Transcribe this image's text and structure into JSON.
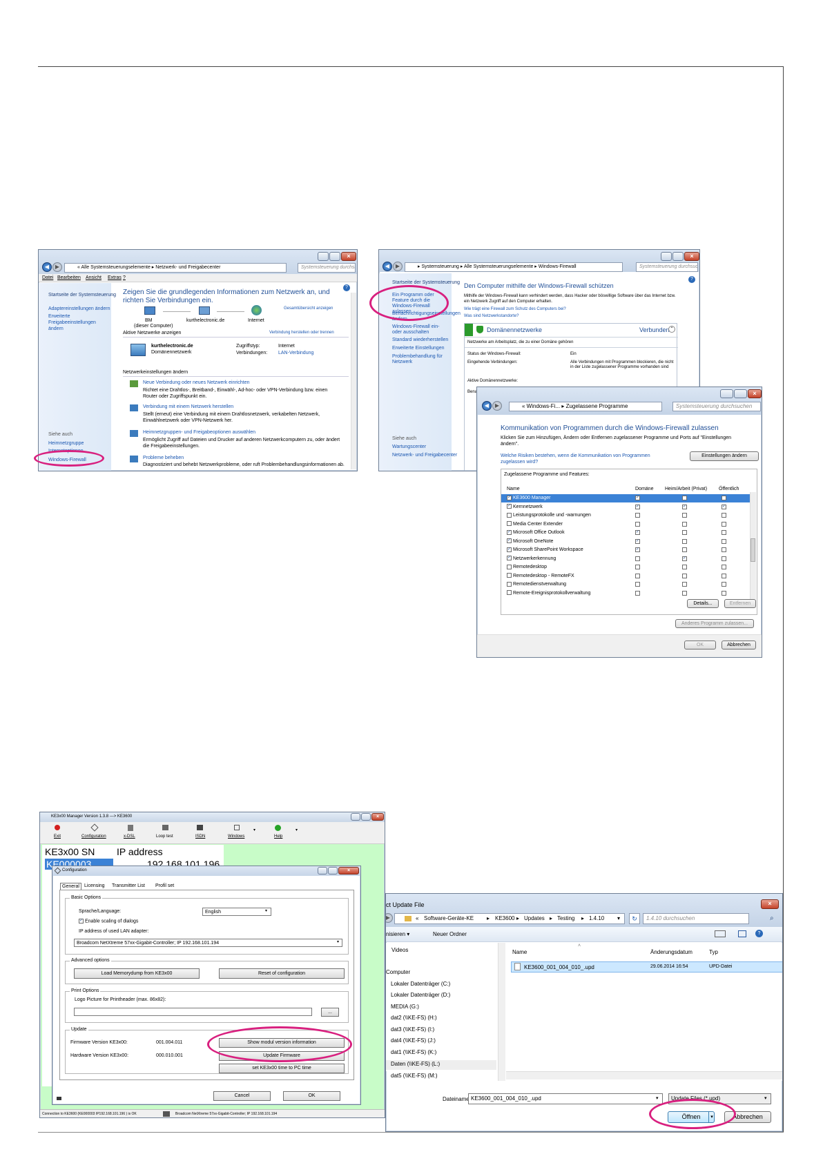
{
  "network_window": {
    "address": "« Alle Systemsteuerungselemente ▸ Netzwerk- und Freigabecenter",
    "search": "Systemsteuerung durchsuchen",
    "menu": [
      "Datei",
      "Bearbeiten",
      "Ansicht",
      "Extras",
      "?"
    ],
    "sidebar": [
      "Startseite der Systemsteuerung",
      "Adaptereinstellungen ändern",
      "Erweiterte Freigabeeinstellungen ändern"
    ],
    "see_also": "Siehe auch",
    "see_also_items": [
      "Heimnetzgruppe",
      "Internetoptionen",
      "Windows-Firewall"
    ],
    "heading": "Zeigen Sie die grundlegenden Informationen zum Netzwerk an, und richten Sie Verbindungen ein.",
    "full_map": "Gesamtübersicht anzeigen",
    "nodes": [
      "BM",
      "(dieser Computer)",
      "kurthelectronic.de",
      "Internet"
    ],
    "active_label": "Aktive Netzwerke anzeigen",
    "connect_link": "Verbindung herstellen oder trennen",
    "network_name": "kurthelectronic.de",
    "network_type": "Domänennetzwerk",
    "access_type_label": "Zugriffstyp:",
    "access_type": "Internet",
    "connections_label": "Verbindungen:",
    "connections": "LAN-Verbindung",
    "change_label": "Netzwerkeinstellungen ändern",
    "tasks": [
      {
        "title": "Neue Verbindung oder neues Netzwerk einrichten",
        "desc": "Richtet eine Drahtlos-, Breitband-, Einwähl-, Ad-hoc- oder VPN-Verbindung bzw. einen Router oder Zugriffspunkt ein."
      },
      {
        "title": "Verbindung mit einem Netzwerk herstellen",
        "desc": "Stellt (erneut) eine Verbindung mit einem Drahtlosnetzwerk, verkabelten Netzwerk, Einwählnetzwerk oder VPN-Netzwerk her."
      },
      {
        "title": "Heimnetzgruppen- und Freigabeoptionen auswählen",
        "desc": "Ermöglicht Zugriff auf Dateien und Drucker auf anderen Netzwerkcomputern zu, oder ändert die Freigabeeinstellungen."
      },
      {
        "title": "Probleme beheben",
        "desc": "Diagnostiziert und behebt Netzwerkprobleme, oder ruft Problembehandlungsinformationen ab."
      }
    ]
  },
  "firewall_window": {
    "address": "▸ Systemsteuerung ▸ Alle Systemsteuerungselemente ▸ Windows-Firewall",
    "search": "Systemsteuerung durchsuchen",
    "sidebar": [
      "Startseite der Systemsteuerung",
      "Ein Programm oder Feature durch die Windows-Firewall zulassen",
      "Benachrichtigungseinstellungen ändern",
      "Windows-Firewall ein- oder ausschalten",
      "Standard wiederherstellen",
      "Erweiterte Einstellungen",
      "Problembehandlung für Netzwerk"
    ],
    "see_also": "Siehe auch",
    "see_also_items": [
      "Wartungscenter",
      "Netzwerk- und Freigabecenter"
    ],
    "heading": "Den Computer mithilfe der Windows-Firewall schützen",
    "intro": "Mithilfe der Windows-Firewall kann verhindert werden, dass Hacker oder böswillige Software über das Internet bzw. ein Netzwerk Zugriff auf den Computer erhalten.",
    "link1": "Wie trägt eine Firewall zum Schutz des Computers bei?",
    "link2": "Was sind Netzwerkstandorte?",
    "domain_net": "Domänennetzwerke",
    "connected": "Verbunden",
    "domain_desc": "Netzwerke am Arbeitsplatz, die zu einer Domäne gehören",
    "status_label": "Status der Windows-Firewall:",
    "status": "Ein",
    "incoming_label": "Eingehende Verbindungen:",
    "incoming": "Alle Verbindungen mit Programmen blockieren, die nicht in der Liste zugelassener Programme vorhanden sind",
    "active_domain": "Aktive Domänennetzwerke:",
    "notify_partial": "Benachrichtigungsstatus:"
  },
  "allowed_window": {
    "address": "« Windows-Fi... ▸ Zugelassene Programme",
    "search": "Systemsteuerung durchsuchen",
    "heading": "Kommunikation von Programmen durch die Windows-Firewall zulassen",
    "intro": "Klicken Sie zum Hinzufügen, Ändern oder Entfernen zugelassener Programme und Ports auf \"Einstellungen ändern\".",
    "risk_link": "Welche Risiken bestehen, wenn die Kommunikation von Programmen zugelassen wird?",
    "change_btn": "Einstellungen ändern",
    "list_label": "Zugelassene Programme und Features:",
    "columns": [
      "Name",
      "Domäne",
      "Heim/Arbeit (Privat)",
      "Öffentlich"
    ],
    "rows": [
      {
        "name": "KE3600 Manager",
        "c": [
          true,
          false,
          false
        ],
        "on": true
      },
      {
        "name": "Kernnetzwerk",
        "c": [
          true,
          true,
          true
        ],
        "on": true
      },
      {
        "name": "Leistungsprotokolle und -warnungen",
        "c": [
          false,
          false,
          false
        ],
        "on": false
      },
      {
        "name": "Media Center Extender",
        "c": [
          false,
          false,
          false
        ],
        "on": false
      },
      {
        "name": "Microsoft Office Outlook",
        "c": [
          true,
          false,
          false
        ],
        "on": true
      },
      {
        "name": "Microsoft OneNote",
        "c": [
          true,
          false,
          false
        ],
        "on": true
      },
      {
        "name": "Microsoft SharePoint Workspace",
        "c": [
          true,
          false,
          false
        ],
        "on": true
      },
      {
        "name": "Netzwerkerkennung",
        "c": [
          false,
          true,
          false
        ],
        "on": true
      },
      {
        "name": "Remotedesktop",
        "c": [
          false,
          false,
          false
        ],
        "on": false
      },
      {
        "name": "Remotedesktop - RemoteFX",
        "c": [
          false,
          false,
          false
        ],
        "on": false
      },
      {
        "name": "Remotedienstverwaltung",
        "c": [
          false,
          false,
          false
        ],
        "on": false
      },
      {
        "name": "Remote-Ereignisprotokollverwaltung",
        "c": [
          false,
          false,
          false
        ],
        "on": false
      }
    ],
    "details_btn": "Details...",
    "remove_btn": "Entfernen",
    "other_btn": "Anderes Programm zulassen...",
    "ok_btn": "OK",
    "cancel_btn": "Abbrechen"
  },
  "manager_window": {
    "title": "KE3x00 Manager Version 1.3.8 ---> KE3600",
    "toolbar": [
      "Exit",
      "Configuration",
      "x-DSL",
      "Loop test",
      "ISDN",
      "Windows",
      "Help"
    ],
    "col_sn": "KE3x00 SN",
    "col_ip": "IP address",
    "sn": "KE000003",
    "ip": "192.168.101.196",
    "status_left": "Connection to KE3600 (KE000003 IP192.168.101.196 ) is OK",
    "status_right": "Broadcom NetXtreme 57xx-Gigabit-Controller; IP 192.168.101.194"
  },
  "config_window": {
    "title": "Configuration",
    "tabs": [
      "General",
      "Licensing",
      "Transmitter List",
      "Profil set"
    ],
    "basic": "Basic Options",
    "language_label": "Sprache/Language:",
    "language": "English",
    "scaling": "Enable scaling of dialogs",
    "adapter_label": "IP address of used LAN adapter:",
    "adapter": "Broadcom NetXtreme 57xx-Gigabit-Controller; IP 192.168.101.194",
    "advanced": "Advanced options",
    "memdump_btn": "Load Memorydump from KE3x00",
    "reset_btn": "Reset of configuration",
    "print": "Print Options",
    "logo_label": "Logo Picture for Printheader (max. 86x82):",
    "browse_btn": "...",
    "update": "Update",
    "fw_label": "Firmware Version KE3x00:",
    "fw": "001.004.011",
    "hw_label": "Hardware Version KE3x00:",
    "hw": "000.010.001",
    "show_btn": "Show modul version information",
    "update_btn": "Update Firmware",
    "time_btn": "set KE3x00 time to PC time",
    "cancel_btn": "Cancel",
    "ok_btn": "OK"
  },
  "file_window": {
    "title": "ct Update File",
    "path": [
      "«",
      "Software-Geräte-KE",
      "KE3600",
      "Updates",
      "Testing",
      "1.4.10"
    ],
    "search": "1.4.10 durchsuchen",
    "organize": "nisieren ▾",
    "new_folder": "Neuer Ordner",
    "tree": [
      "Videos",
      "Computer",
      "Lokaler Datenträger (C:)",
      "Lokaler Datenträger (D:)",
      "MEDIA (G:)",
      "dat2 (\\\\KE-FS) (H:)",
      "dat3 (\\\\KE-FS) (I:)",
      "dat4 (\\\\KE-FS) (J:)",
      "dat1 (\\\\KE-FS) (K:)",
      "Daten (\\\\KE-FS) (L:)",
      "dat5 (\\\\KE-FS) (M:)"
    ],
    "col_name": "Name",
    "col_date": "Änderungsdatum",
    "col_type": "Typ",
    "file_name": "KE3600_001_004_010_.upd",
    "file_date": "29.06.2014 16:54",
    "file_type": "UPD-Datei",
    "filename_label": "Dateiname:",
    "filename": "KE3600_001_004_010_.upd",
    "filter": "Update Files (*.upd)",
    "open_btn": "Öffnen",
    "cancel_btn": "Abbrechen"
  }
}
